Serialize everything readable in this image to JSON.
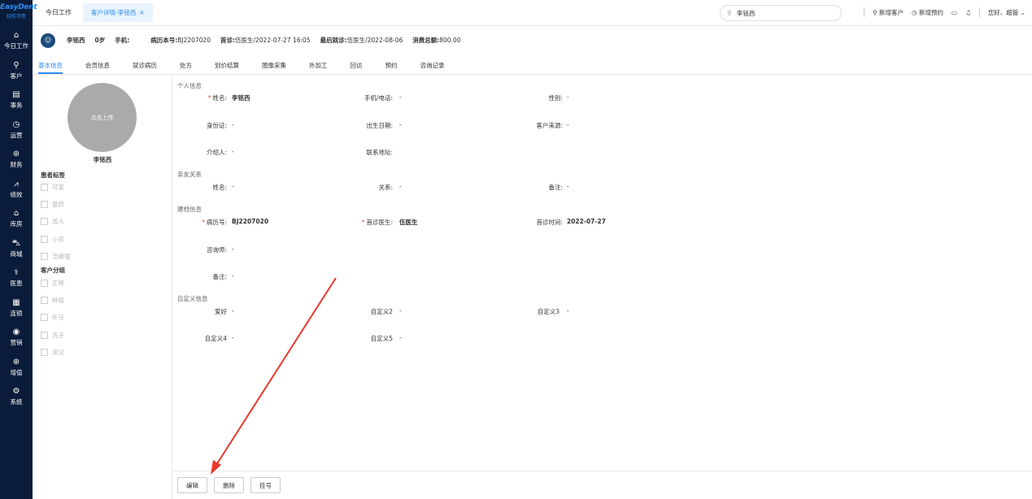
{
  "app": {
    "logo_line1": "EasyDent",
    "logo_line2": "轻松牙医"
  },
  "sidebar": {
    "items": [
      {
        "icon": "home-icon",
        "glyph": "⌂",
        "label": "今日工作"
      },
      {
        "icon": "user-icon",
        "glyph": "⚲",
        "label": "客户"
      },
      {
        "icon": "task-icon",
        "glyph": "▤",
        "label": "事务"
      },
      {
        "icon": "clock-icon",
        "glyph": "◷",
        "label": "运营"
      },
      {
        "icon": "money-icon",
        "glyph": "⊛",
        "label": "财务"
      },
      {
        "icon": "chart-icon",
        "glyph": "⩘",
        "label": "绩效"
      },
      {
        "icon": "warehouse-icon",
        "glyph": "⌂",
        "label": "库房"
      },
      {
        "icon": "cart-icon",
        "glyph": "⛍",
        "label": "商城"
      },
      {
        "icon": "doctor-icon",
        "glyph": "⚕",
        "label": "医患"
      },
      {
        "icon": "chain-icon",
        "glyph": "▦",
        "label": "连锁"
      },
      {
        "icon": "marketing-icon",
        "glyph": "◉",
        "label": "营销"
      },
      {
        "icon": "value-icon",
        "glyph": "⊕",
        "label": "增值"
      },
      {
        "icon": "gear-icon",
        "glyph": "⚙",
        "label": "系统"
      }
    ]
  },
  "topbar": {
    "home_tab": "今日工作",
    "active_tab": "客户详情-李铭西",
    "close_glyph": "×",
    "search_value": "李铭西",
    "add_customer": "新增客户",
    "add_appointment": "新增预约",
    "greeting": "您好、超管"
  },
  "patient": {
    "name": "李铭西",
    "age": "0岁",
    "phone_label": "手机:",
    "record_label": "病历本号:",
    "record_value": "BJ2207020",
    "first_label": "首诊:",
    "first_value": "伍医生/2022-07-27 16:05",
    "last_label": "最后就诊:",
    "last_value": "伍医生/2022-08-06",
    "total_label": "消费总额:",
    "total_value": "800.00"
  },
  "tabs": [
    "基本信息",
    "会员信息",
    "就诊病历",
    "处方",
    "划价结算",
    "图像采集",
    "外加工",
    "回访",
    "预约",
    "咨询记录"
  ],
  "left": {
    "upload_text": "点击上传",
    "name": "李铭西",
    "tags_title": "患者标签",
    "tags": [
      "可爱",
      "傲娇",
      "成人",
      "小孩",
      "洁癖强"
    ],
    "groups_title": "客户分组",
    "groups": [
      "正畸",
      "种植",
      "补牙",
      "洗牙",
      "测试"
    ]
  },
  "main": {
    "personal": {
      "title": "个人信息",
      "name_label": "姓名:",
      "name_value": "李铭西",
      "phone_label": "手机/电话:",
      "phone_value": "-",
      "gender_label": "性别:",
      "gender_value": "-",
      "id_label": "身份证:",
      "id_value": "-",
      "birth_label": "出生日期:",
      "birth_value": "-",
      "source_label": "客户来源:",
      "source_value": "-",
      "referrer_label": "介绍人:",
      "referrer_value": "-",
      "address_label": "联系地址:"
    },
    "relatives": {
      "title": "亲友关系",
      "name_label": "姓名:",
      "name_value": "-",
      "relation_label": "关系:",
      "relation_value": "-",
      "note_label": "备注:",
      "note_value": "-"
    },
    "record": {
      "title": "建档信息",
      "no_label": "病历号:",
      "no_value": "BJ2207020",
      "doctor_label": "首诊医生:",
      "doctor_value": "伍医生",
      "time_label": "首诊时间:",
      "time_value": "2022-07-27",
      "consultant_label": "咨询师:",
      "consultant_value": "-",
      "note_label": "备注:",
      "note_value": "-"
    },
    "custom": {
      "title": "自定义信息",
      "hobby_label": "爱好",
      "hobby_value": "-",
      "c2_label": "自定义2",
      "c2_value": "-",
      "c3_label": "自定义3",
      "c3_value": "-",
      "c4_label": "自定义4",
      "c4_value": "-",
      "c5_label": "自定义5",
      "c5_value": "-"
    }
  },
  "footer": {
    "edit": "编辑",
    "delete": "删除",
    "register": "挂号"
  },
  "colors": {
    "sidebar_bg": "#0a1c3a",
    "accent": "#2d8cf0",
    "arrow": "#e8392b"
  }
}
